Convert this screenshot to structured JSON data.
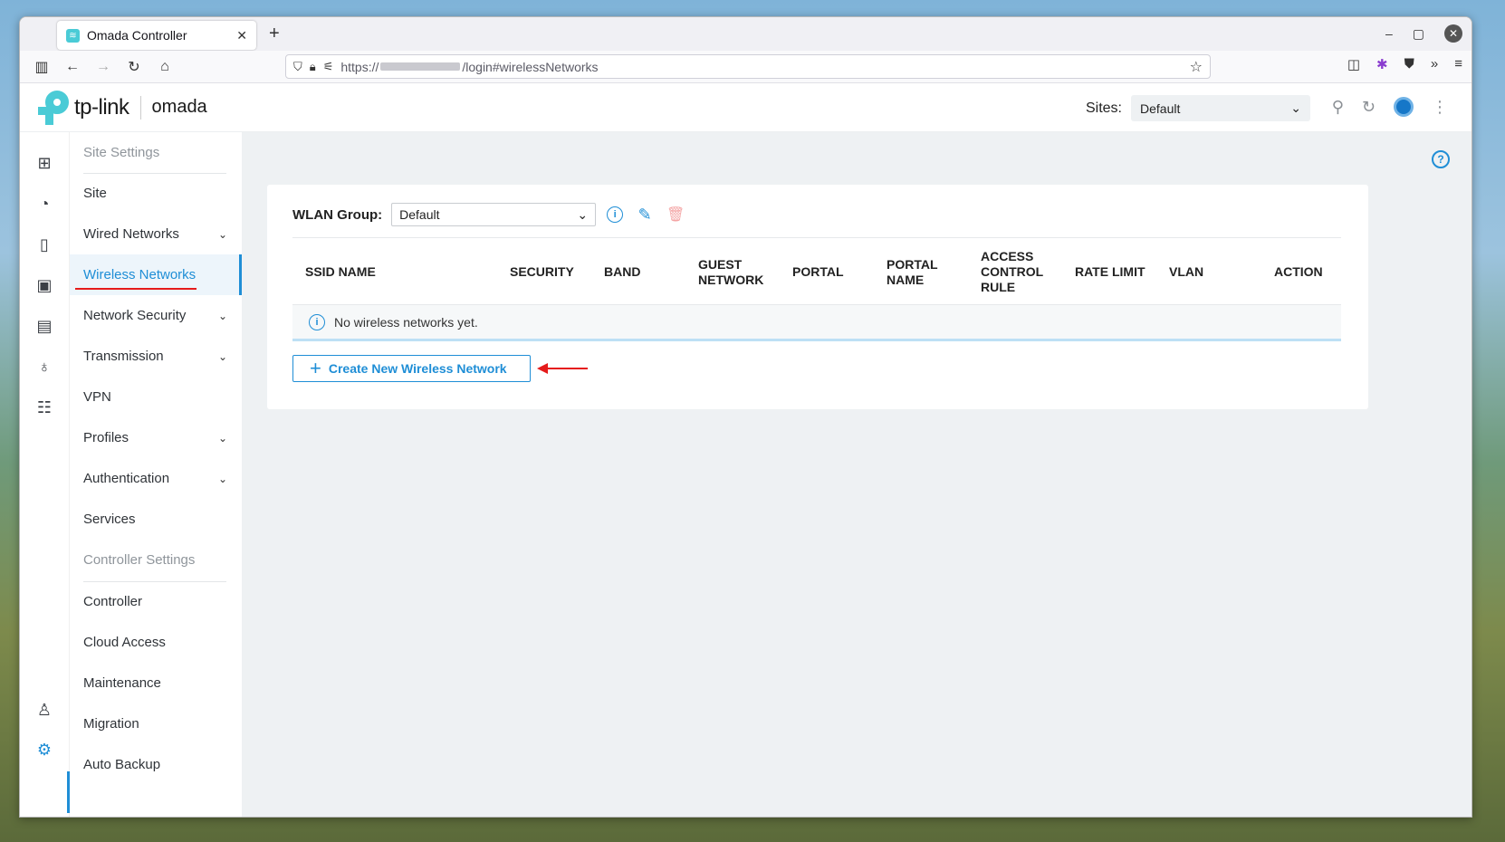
{
  "browser": {
    "tab_title": "Omada Controller",
    "url_prefix": "https://",
    "url_suffix": "/login#wirelessNetworks"
  },
  "header": {
    "logo_text": "tp-link",
    "product_text": "omada",
    "sites_label": "Sites:",
    "sites_value": "Default"
  },
  "sidebar": {
    "items": [
      {
        "label": "Site Settings",
        "type": "section"
      },
      {
        "label": "Site"
      },
      {
        "label": "Wired Networks",
        "expandable": true
      },
      {
        "label": "Wireless Networks",
        "active": true
      },
      {
        "label": "Network Security",
        "expandable": true
      },
      {
        "label": "Transmission",
        "expandable": true
      },
      {
        "label": "VPN"
      },
      {
        "label": "Profiles",
        "expandable": true
      },
      {
        "label": "Authentication",
        "expandable": true
      },
      {
        "label": "Services"
      },
      {
        "label": "Controller Settings",
        "type": "section"
      },
      {
        "label": "Controller"
      },
      {
        "label": "Cloud Access"
      },
      {
        "label": "Maintenance"
      },
      {
        "label": "Migration"
      },
      {
        "label": "Auto Backup"
      }
    ]
  },
  "main": {
    "wlan_group_label": "WLAN Group:",
    "wlan_group_value": "Default",
    "columns": [
      "SSID NAME",
      "SECURITY",
      "BAND",
      "GUEST NETWORK",
      "PORTAL",
      "PORTAL NAME",
      "ACCESS CONTROL RULE",
      "RATE LIMIT",
      "VLAN",
      "ACTION"
    ],
    "empty_message": "No wireless networks yet.",
    "create_button": "Create New Wireless Network"
  },
  "colors": {
    "accent": "#1f8ed6",
    "annotation": "#e51b1b",
    "brand": "#4acbd6"
  }
}
